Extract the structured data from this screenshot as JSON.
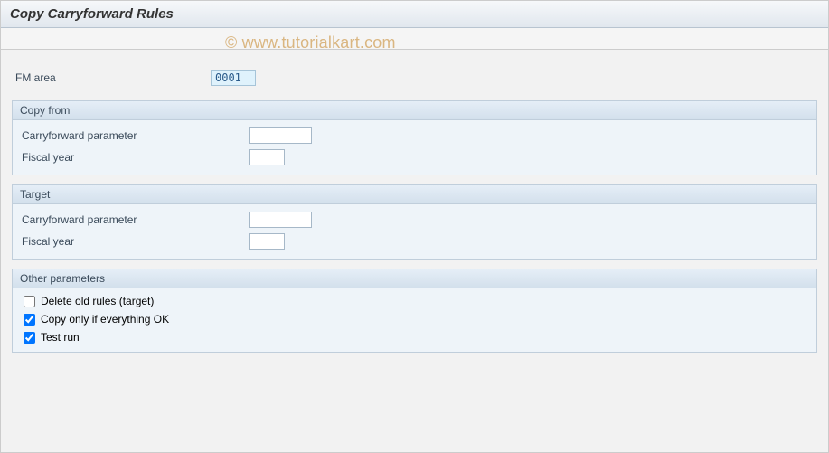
{
  "title": "Copy Carryforward Rules",
  "watermark": "© www.tutorialkart.com",
  "fm_area": {
    "label": "FM area",
    "value": "0001"
  },
  "groups": {
    "copy_from": {
      "title": "Copy from",
      "carryforward_param": {
        "label": "Carryforward parameter",
        "value": ""
      },
      "fiscal_year": {
        "label": "Fiscal year",
        "value": ""
      }
    },
    "target": {
      "title": "Target",
      "carryforward_param": {
        "label": "Carryforward parameter",
        "value": ""
      },
      "fiscal_year": {
        "label": "Fiscal year",
        "value": ""
      }
    },
    "other": {
      "title": "Other parameters",
      "delete_old": {
        "label": "Delete old rules (target)",
        "checked": false
      },
      "copy_ok": {
        "label": "Copy only if everything OK",
        "checked": true
      },
      "test_run": {
        "label": "Test run",
        "checked": true
      }
    }
  }
}
